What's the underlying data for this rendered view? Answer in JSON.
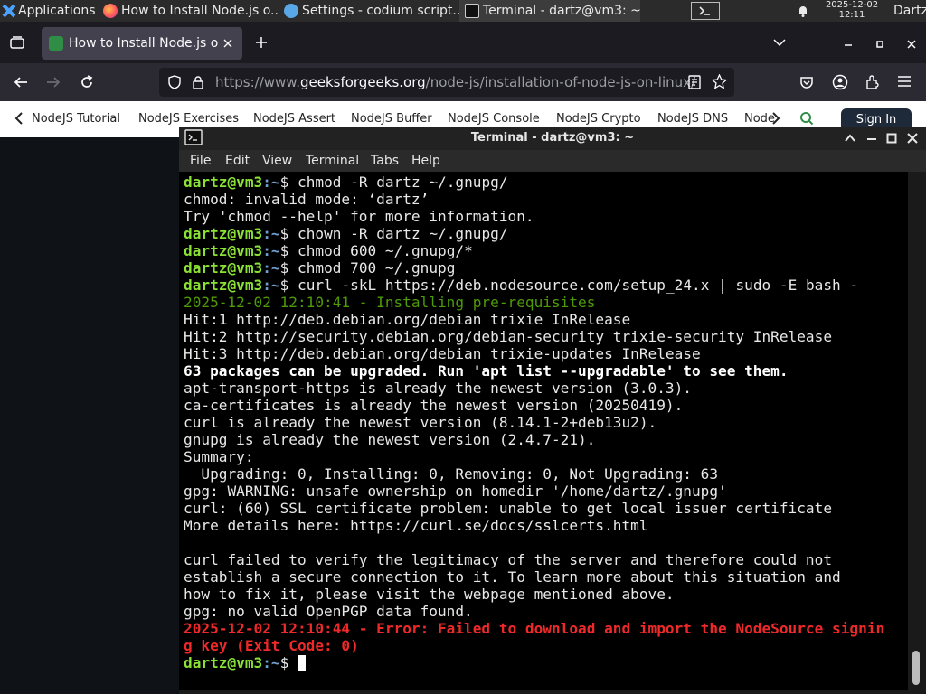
{
  "panel": {
    "applications": "Applications",
    "tasks": [
      {
        "label": "How to Install Node.js o..."
      },
      {
        "label": "Settings - codium script..."
      },
      {
        "label": "Terminal - dartz@vm3: ~"
      }
    ],
    "date": "2025-12-02",
    "time": "12:11",
    "user": "Dartz"
  },
  "browser": {
    "tab_title": "How to Install Node.js on",
    "url_prefix": "https://www.",
    "url_host": "geeksforgeeks.org",
    "url_path": "/node-js/installation-of-node-js-on-linux/",
    "bookmarks": [
      "NodeJS Tutorial",
      "NodeJS Exercises",
      "NodeJS Assert",
      "NodeJS Buffer",
      "NodeJS Console",
      "NodeJS Crypto",
      "NodeJS DNS",
      "Node"
    ],
    "signin": "Sign In"
  },
  "terminal": {
    "title": "Terminal - dartz@vm3: ~",
    "menu": [
      "File",
      "Edit",
      "View",
      "Terminal",
      "Tabs",
      "Help"
    ],
    "prompt_user": "dartz@vm3",
    "prompt_path": ":~",
    "prompt_sign": "$ ",
    "lines": [
      {
        "kind": "cmd",
        "text": "chmod -R dartz ~/.gnupg/"
      },
      {
        "kind": "out",
        "text": "chmod: invalid mode: ‘dartz’"
      },
      {
        "kind": "out",
        "text": "Try 'chmod --help' for more information."
      },
      {
        "kind": "cmd",
        "text": "chown -R dartz ~/.gnupg/"
      },
      {
        "kind": "cmd",
        "text": "chmod 600 ~/.gnupg/*"
      },
      {
        "kind": "cmd",
        "text": "chmod 700 ~/.gnupg"
      },
      {
        "kind": "cmd",
        "text": "curl -skL https://deb.nodesource.com/setup_24.x | sudo -E bash -"
      },
      {
        "kind": "info",
        "text": "2025-12-02 12:10:41 - Installing pre-requisites"
      },
      {
        "kind": "out",
        "text": "Hit:1 http://deb.debian.org/debian trixie InRelease"
      },
      {
        "kind": "out",
        "text": "Hit:2 http://security.debian.org/debian-security trixie-security InRelease"
      },
      {
        "kind": "out",
        "text": "Hit:3 http://deb.debian.org/debian trixie-updates InRelease"
      },
      {
        "kind": "bold",
        "text": "63 packages can be upgraded. Run 'apt list --upgradable' to see them."
      },
      {
        "kind": "out",
        "text": "apt-transport-https is already the newest version (3.0.3)."
      },
      {
        "kind": "out",
        "text": "ca-certificates is already the newest version (20250419)."
      },
      {
        "kind": "out",
        "text": "curl is already the newest version (8.14.1-2+deb13u2)."
      },
      {
        "kind": "out",
        "text": "gnupg is already the newest version (2.4.7-21)."
      },
      {
        "kind": "out",
        "text": "Summary:"
      },
      {
        "kind": "out",
        "text": "  Upgrading: 0, Installing: 0, Removing: 0, Not Upgrading: 63"
      },
      {
        "kind": "out",
        "text": "gpg: WARNING: unsafe ownership on homedir '/home/dartz/.gnupg'"
      },
      {
        "kind": "out",
        "text": "curl: (60) SSL certificate problem: unable to get local issuer certificate"
      },
      {
        "kind": "out",
        "text": "More details here: https://curl.se/docs/sslcerts.html"
      },
      {
        "kind": "out",
        "text": ""
      },
      {
        "kind": "out",
        "text": "curl failed to verify the legitimacy of the server and therefore could not"
      },
      {
        "kind": "out",
        "text": "establish a secure connection to it. To learn more about this situation and"
      },
      {
        "kind": "out",
        "text": "how to fix it, please visit the webpage mentioned above."
      },
      {
        "kind": "out",
        "text": "gpg: no valid OpenPGP data found."
      },
      {
        "kind": "error",
        "text": "2025-12-02 12:10:44 - Error: Failed to download and import the NodeSource signin"
      },
      {
        "kind": "error",
        "text": "g key (Exit Code: 0)"
      },
      {
        "kind": "prompt",
        "text": ""
      }
    ]
  },
  "colors": {
    "prompt_user": "#8ae234",
    "prompt_path": "#729fcf",
    "info": "#4e9a06",
    "error": "#ef2929"
  }
}
